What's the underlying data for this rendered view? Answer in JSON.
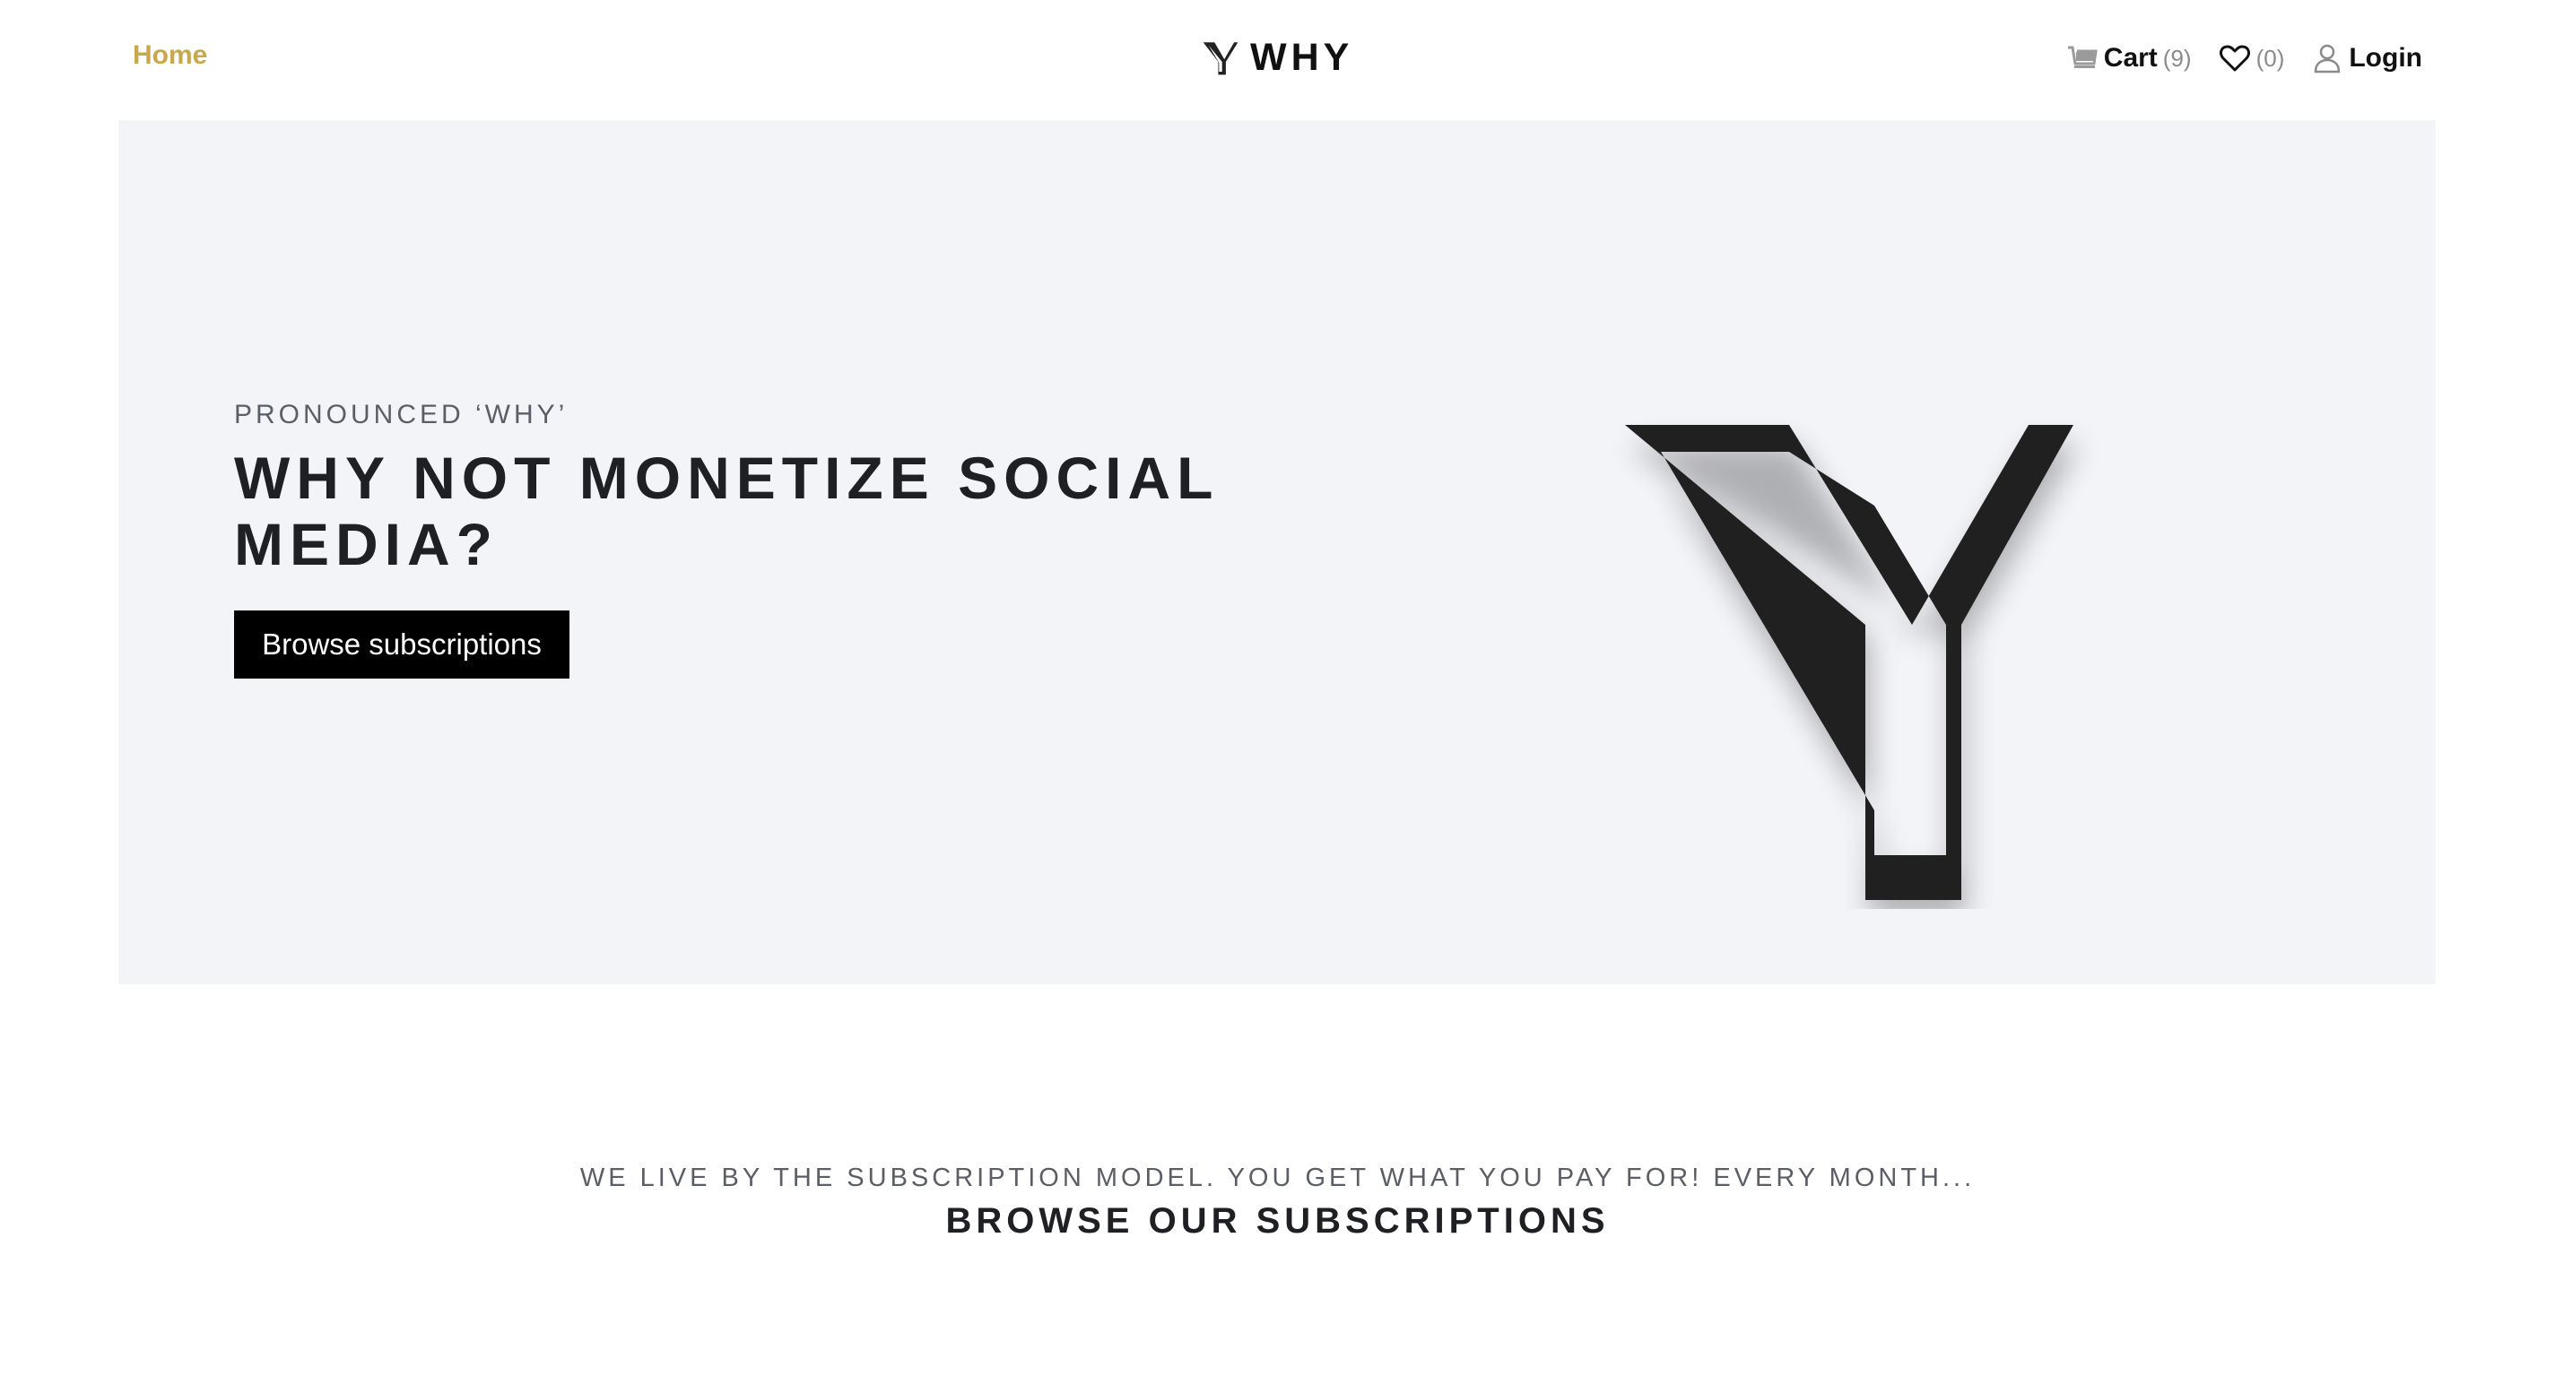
{
  "header": {
    "home_label": "Home",
    "brand_name": "WHY",
    "cart_label": "Cart",
    "cart_count": "(9)",
    "wishlist_count": "(0)",
    "login_label": "Login"
  },
  "hero": {
    "eyebrow": "PRONOUNCED ‘WHY’",
    "headline": "WHY NOT MONETIZE SOCIAL MEDIA?",
    "cta_label": "Browse subscriptions",
    "background_color": "#f3f4f8"
  },
  "subscriptions_section": {
    "subtitle": "WE LIVE BY THE SUBSCRIPTION MODEL. YOU GET WHAT YOU PAY FOR! EVERY MONTH...",
    "title": "BROWSE OUR SUBSCRIPTIONS"
  },
  "icons": {
    "brand": "y-logo-icon",
    "cart": "cart-icon",
    "wishlist": "heart-icon",
    "login": "user-icon"
  },
  "colors": {
    "accent": "#c9a84c",
    "cta_background": "#000000",
    "text_dark": "#1f2024",
    "text_muted": "#5b5e66"
  }
}
